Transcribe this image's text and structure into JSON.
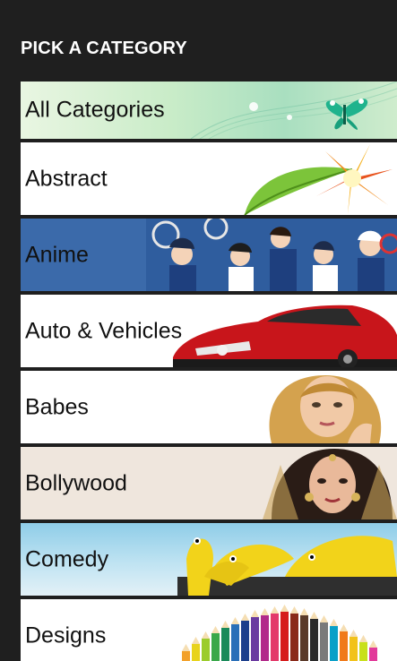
{
  "header": {
    "title": "PICK A CATEGORY"
  },
  "categories": [
    {
      "label": "All Categories",
      "art": "butterfly-icon",
      "bg": "#cfead0"
    },
    {
      "label": "Abstract",
      "art": "flower-leaf-icon",
      "bg": "#ffffff"
    },
    {
      "label": "Anime",
      "art": "anime-tennis-characters",
      "bg": "#3b6aaa"
    },
    {
      "label": "Auto & Vehicles",
      "art": "red-car",
      "bg": "#ffffff"
    },
    {
      "label": "Babes",
      "art": "woman-portrait",
      "bg": "#ffffff"
    },
    {
      "label": "Bollywood",
      "art": "bollywood-portrait",
      "bg": "#efe6dd"
    },
    {
      "label": "Comedy",
      "art": "rubber-chickens",
      "bg": "#8fcde8"
    },
    {
      "label": "Designs",
      "art": "colored-pencils",
      "bg": "#ffffff"
    }
  ]
}
